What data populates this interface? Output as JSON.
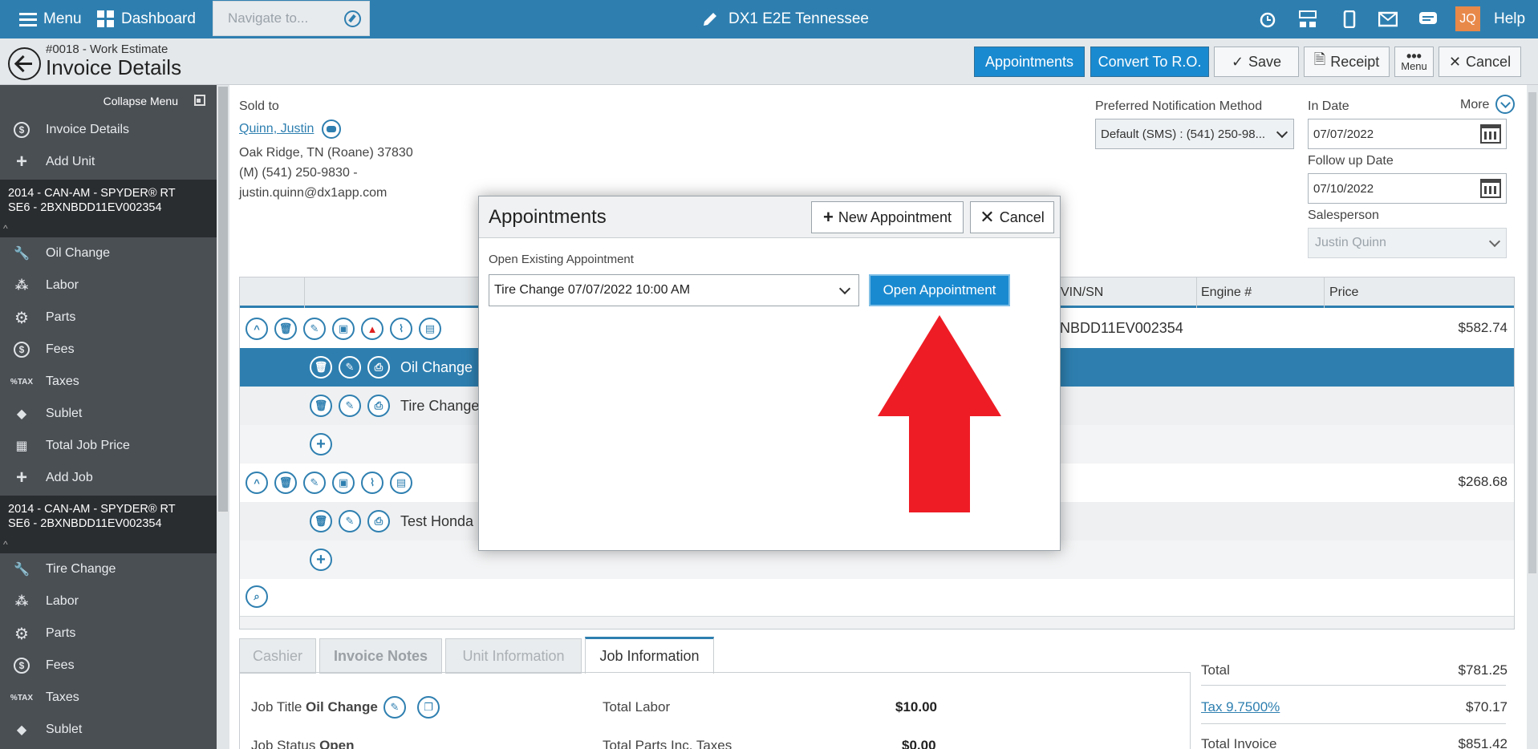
{
  "topbar": {
    "menu_label": "Menu",
    "dashboard_label": "Dashboard",
    "navigate_placeholder": "Navigate to...",
    "store_name": "DX1 E2E Tennessee",
    "user_initials": "JQ",
    "help_label": "Help"
  },
  "header": {
    "subtitle": "#0018 - Work Estimate",
    "title": "Invoice Details",
    "buttons": {
      "appointments": "Appointments",
      "convert": "Convert To R.O.",
      "save": "Save",
      "receipt": "Receipt",
      "menu": "Menu",
      "cancel": "Cancel"
    }
  },
  "sidebar": {
    "collapse_label": "Collapse Menu",
    "top_items": [
      "Invoice Details",
      "Add Unit"
    ],
    "unit1": {
      "line1": "2014 - CAN-AM - SPYDER® RT",
      "line2": "SE6 - 2BXNBDD11EV002354"
    },
    "unit1_items": [
      "Oil Change",
      "Labor",
      "Parts",
      "Fees",
      "Taxes",
      "Sublet",
      "Total Job Price",
      "Add Job"
    ],
    "unit2": {
      "line1": "2014 - CAN-AM - SPYDER® RT",
      "line2": "SE6 - 2BXNBDD11EV002354"
    },
    "unit2_items": [
      "Tire Change",
      "Labor",
      "Parts",
      "Fees",
      "Taxes",
      "Sublet"
    ]
  },
  "customer": {
    "sold_to_label": "Sold to",
    "name": "Quinn, Justin",
    "address": "Oak Ridge, TN (Roane) 37830",
    "phone": "(M) (541) 250-9830 -",
    "email": "justin.quinn@dx1app.com"
  },
  "notification": {
    "label": "Preferred Notification Method",
    "value": "Default (SMS) : (541) 250-98..."
  },
  "dates": {
    "in_date_label": "In Date",
    "in_date": "07/07/2022",
    "follow_label": "Follow up Date",
    "follow_date": "07/10/2022",
    "salesperson_label": "Salesperson",
    "salesperson": "Justin Quinn",
    "more_label": "More"
  },
  "grid": {
    "columns": {
      "vin": "VIN/SN",
      "engine": "Engine #",
      "price": "Price"
    },
    "unit1_vin_partial": "NBDD11EV002354",
    "unit1_price": "$582.74",
    "unit2_price": "$268.68",
    "jobs": [
      "Oil Change",
      "Tire Change",
      "Test Honda"
    ]
  },
  "tabs": [
    "Cashier",
    "Invoice Notes",
    "Unit Information",
    "Job Information"
  ],
  "job_info": {
    "job_title_label": "Job Title",
    "job_title": "Oil Change",
    "job_status_label": "Job Status",
    "job_status": "Open",
    "total_labor_label": "Total Labor",
    "total_labor": "$10.00",
    "total_parts_label": "Total Parts Inc. Taxes",
    "total_parts": "$0.00"
  },
  "totals": {
    "total_label": "Total",
    "total": "$781.25",
    "tax_label": "Tax 9.7500%",
    "tax": "$70.17",
    "invoice_label": "Total Invoice",
    "invoice": "$851.42"
  },
  "modal": {
    "title": "Appointments",
    "new_label": "New Appointment",
    "cancel_label": "Cancel",
    "field_label": "Open Existing Appointment",
    "selected": "Tire Change 07/07/2022 10:00 AM",
    "open_label": "Open Appointment"
  },
  "colors": {
    "brand": "#2e7fb0",
    "button_blue": "#1a8ad0",
    "arrow": "#ee1c25"
  }
}
